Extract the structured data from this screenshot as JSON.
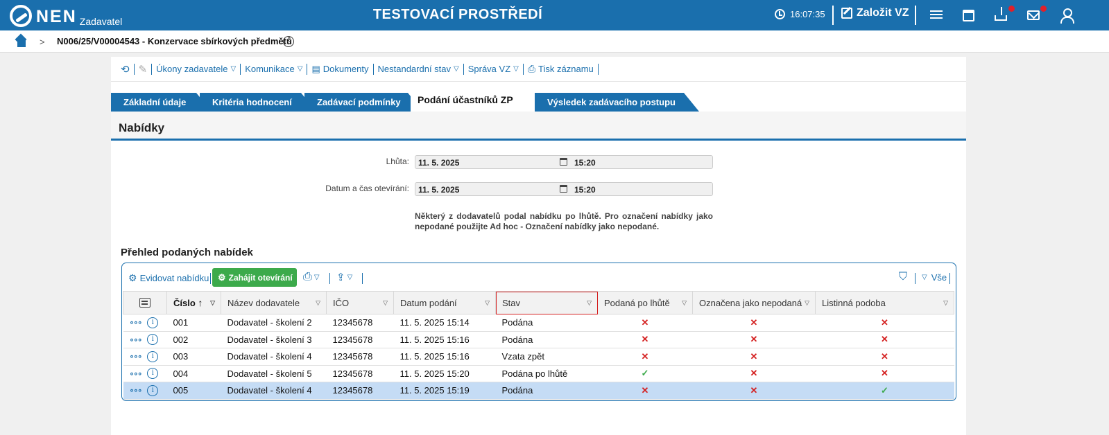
{
  "topbar": {
    "logo_text": "NEN",
    "logo_sub": "Zadavatel",
    "environment_title": "TESTOVACÍ PROSTŘEDÍ",
    "time": "16:07:35",
    "create_label": "Založit VZ",
    "icons": [
      "clock-icon",
      "edit-icon",
      "menu-icon",
      "calendar-icon",
      "download-icon",
      "mail-icon",
      "user-icon"
    ],
    "accent_color": "#1a6fad"
  },
  "breadcrumb": {
    "path": "N006/25/V00004543 - Konzervace sbírkových předmětů"
  },
  "toolbar": {
    "ukony": "Úkony zadavatele",
    "komunikace": "Komunikace",
    "dokumenty": "Dokumenty",
    "nestandardni": "Nestandardní stav",
    "sprava": "Správa VZ",
    "tisk": "Tisk záznamu"
  },
  "tabs": [
    {
      "label": "Základní údaje",
      "active": false
    },
    {
      "label": "Kritéria hodnocení",
      "active": false
    },
    {
      "label": "Zadávací podmínky",
      "active": false
    },
    {
      "label": "Podání účastníků ZP",
      "active": true
    },
    {
      "label": "Výsledek zadávacího postupu",
      "active": false
    }
  ],
  "section": {
    "title": "Nabídky"
  },
  "form": {
    "lhuta_label": "Lhůta:",
    "lhuta_date": "11. 5. 2025",
    "lhuta_time": "15:20",
    "otevirani_label": "Datum a čas otevírání:",
    "otevirani_date": "11. 5. 2025",
    "otevirani_time": "15:20",
    "notice": "Některý z dodavatelů podal nabídku po lhůtě. Pro označení nabídky jako nepodané použijte Ad hoc - Označení nabídky jako nepodané."
  },
  "grid": {
    "title": "Přehled podaných nabídek",
    "evidovat": "Evidovat nabídku",
    "zahajit": "Zahájit otevírání",
    "filter_all": "Vše",
    "columns": [
      "Číslo",
      "Název dodavatele",
      "IČO",
      "Datum podání",
      "Stav",
      "Podaná po lhůtě",
      "Označena jako nepodaná",
      "Listinná podoba"
    ],
    "sort_column": "Číslo",
    "highlighted_column": "Stav",
    "rows": [
      {
        "cislo": "001",
        "nazev": "Dodavatel - školení 2",
        "ico": "12345678",
        "datum": "11. 5. 2025 15:14",
        "stav": "Podána",
        "po_lhute": false,
        "nepodana": false,
        "listinna": false,
        "selected": false
      },
      {
        "cislo": "002",
        "nazev": "Dodavatel - školení 3",
        "ico": "12345678",
        "datum": "11. 5. 2025 15:16",
        "stav": "Podána",
        "po_lhute": false,
        "nepodana": false,
        "listinna": false,
        "selected": false
      },
      {
        "cislo": "003",
        "nazev": "Dodavatel - školení 4",
        "ico": "12345678",
        "datum": "11. 5. 2025 15:16",
        "stav": "Vzata zpět",
        "po_lhute": false,
        "nepodana": false,
        "listinna": false,
        "selected": false
      },
      {
        "cislo": "004",
        "nazev": "Dodavatel - školení 5",
        "ico": "12345678",
        "datum": "11. 5. 2025 15:20",
        "stav": "Podána po lhůtě",
        "po_lhute": true,
        "nepodana": false,
        "listinna": false,
        "selected": false
      },
      {
        "cislo": "005",
        "nazev": "Dodavatel - školení 4",
        "ico": "12345678",
        "datum": "11. 5. 2025 15:19",
        "stav": "Podána",
        "po_lhute": false,
        "nepodana": false,
        "listinna": true,
        "selected": true
      }
    ],
    "colors": {
      "yes": "#3caa4b",
      "no": "#d42020",
      "selected_row": "#c5dcf5"
    }
  }
}
